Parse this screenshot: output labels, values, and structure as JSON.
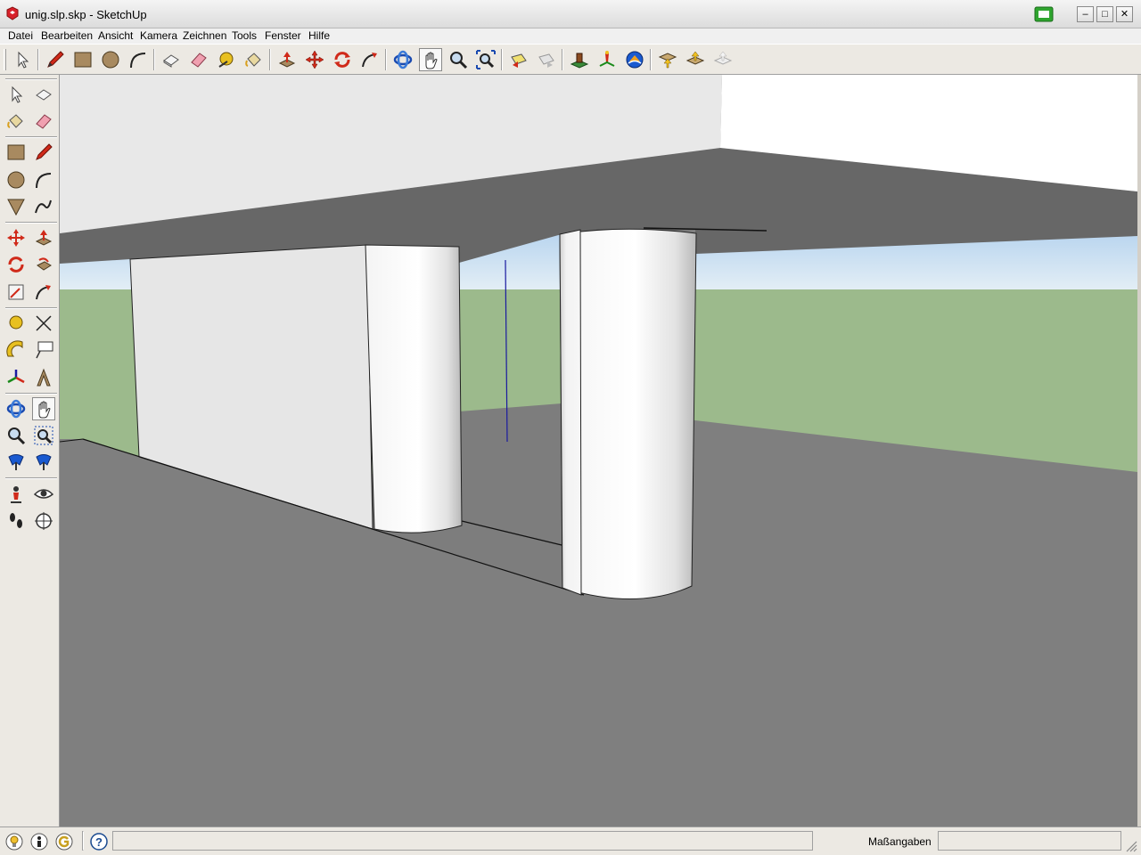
{
  "window": {
    "title": "unig.slp.skp - SketchUp",
    "controls": [
      "minimize",
      "maximize",
      "close"
    ]
  },
  "menu": {
    "items": [
      "Datei",
      "Bearbeiten",
      "Ansicht",
      "Kamera",
      "Zeichnen",
      "Tools",
      "Fenster",
      "Hilfe"
    ]
  },
  "toolbar": {
    "tools": [
      "select-icon",
      "pencil-icon",
      "rectangle-icon",
      "circle-icon",
      "arc-icon",
      "make-component-icon",
      "eraser-icon",
      "tape-measure-icon",
      "paint-bucket-icon",
      "push-pull-icon",
      "move-icon",
      "rotate-icon",
      "follow-me-icon",
      "orbit-icon",
      "pan-icon",
      "zoom-icon",
      "zoom-extents-icon",
      "previous-view-icon",
      "next-view-icon",
      "google-earth-view-icon",
      "place-model-icon",
      "get-models-icon",
      "share-model-icon",
      "get-photo-textures-icon",
      "upload-component-icon",
      "download-component-icon"
    ],
    "active": "pan-icon"
  },
  "lefttools": {
    "tools": [
      "select-icon",
      "make-component-icon",
      "paint-bucket-icon",
      "eraser-icon",
      "rectangle-icon",
      "line-icon",
      "circle-icon",
      "arc-icon",
      "polygon-icon",
      "freehand-icon",
      "move-icon",
      "push-pull-icon",
      "rotate-icon",
      "follow-me-icon",
      "scale-icon",
      "offset-icon",
      "tape-measure-icon",
      "dimension-icon",
      "protractor-icon",
      "text-icon",
      "axes-icon",
      "3d-text-icon",
      "orbit-icon",
      "pan-icon",
      "zoom-icon",
      "zoom-window-icon",
      "zoom-extents-icon",
      "previous-view-icon",
      "position-camera-icon",
      "look-around-icon",
      "walk-icon",
      "section-plane-icon"
    ],
    "active": "pan-icon"
  },
  "statusbar": {
    "icons": [
      "geolocation-icon",
      "credits-icon",
      "sign-in-icon",
      "help-icon"
    ],
    "vcb_label": "Maßangaben",
    "vcb_value": ""
  },
  "colors": {
    "sky": "#c9dff0",
    "ground": "#9cba8c",
    "slab_underside": "#676767",
    "floor": "#7f7f7f",
    "wall": "#e5e5e5",
    "column_white": "#ffffff",
    "axis_blue": "#1a1aa0"
  }
}
